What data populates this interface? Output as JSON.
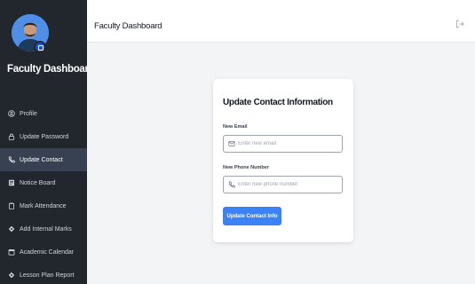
{
  "sidebar": {
    "brand": "Faculty Dashboard",
    "items": [
      {
        "label": "Profile",
        "icon": "user-circle-icon",
        "active": false
      },
      {
        "label": "Update Password",
        "icon": "lock-icon",
        "active": false
      },
      {
        "label": "Update Contact",
        "icon": "phone-icon",
        "active": true
      },
      {
        "label": "Notice Board",
        "icon": "notice-board-icon",
        "active": false
      },
      {
        "label": "Mark Attendance",
        "icon": "clipboard-icon",
        "active": false
      },
      {
        "label": "Add Internal Marks",
        "icon": "marks-icon",
        "active": false
      },
      {
        "label": "Academic Calendar",
        "icon": "calendar-icon",
        "active": false
      },
      {
        "label": "Lesson Plan Report",
        "icon": "report-icon",
        "active": false
      }
    ]
  },
  "header": {
    "title": "Faculty Dashboard",
    "logout_icon": "logout-icon"
  },
  "form": {
    "title": "Update Contact Information",
    "email_label": "New Email",
    "email_placeholder": "Enter new email",
    "email_value": "",
    "phone_label": "New Phone Number",
    "phone_placeholder": "Enter new phone number",
    "phone_value": "",
    "submit_label": "Update Contact Info"
  },
  "colors": {
    "sidebar_bg": "#22272e",
    "active_item_bg": "#374151",
    "accent": "#3b82f6",
    "page_bg": "#f3f4f6"
  }
}
